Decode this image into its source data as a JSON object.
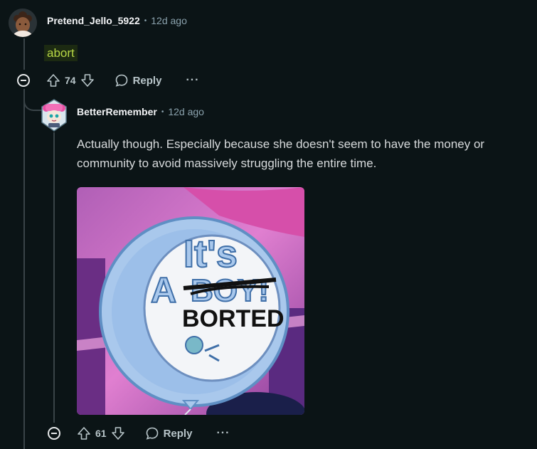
{
  "comments": [
    {
      "username": "Pretend_Jello_5922",
      "separator": "•",
      "time": "12d ago",
      "text": "abort",
      "votes": "74",
      "reply_label": "Reply",
      "more_label": "···"
    },
    {
      "username": "BetterRemember",
      "separator": "•",
      "time": "12d ago",
      "text_line1": "Actually though. Especially because she doesn't seem to have the money or",
      "text_line2": "community to avoid massively struggling the entire time.",
      "image": {
        "line1": "It's",
        "line2_prefix": "A",
        "line2_strike": "BOY!",
        "line3": "BORTED"
      },
      "votes": "61",
      "reply_label": "Reply",
      "more_label": "···"
    }
  ],
  "colors": {
    "background": "#0b1416",
    "highlight_bg": "#1c2a12",
    "highlight_text": "#b8d846",
    "balloon": "#a9c8ec"
  }
}
